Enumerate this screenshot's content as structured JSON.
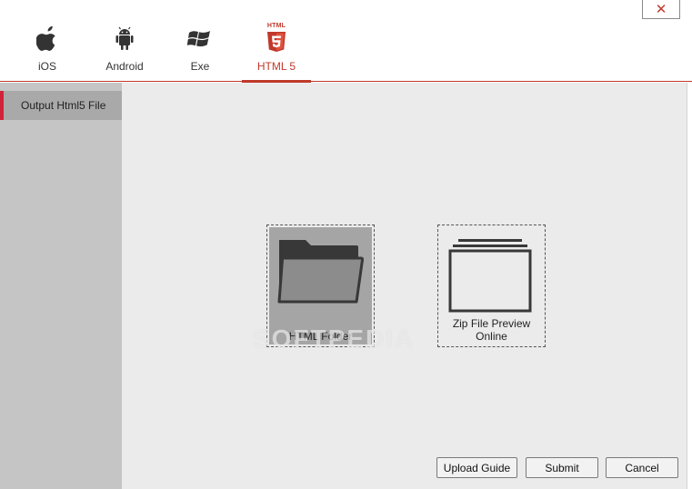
{
  "window": {
    "close_symbol": "✕"
  },
  "tabs": [
    {
      "label": "iOS",
      "icon": "apple-icon"
    },
    {
      "label": "Android",
      "icon": "android-icon"
    },
    {
      "label": "Exe",
      "icon": "windows-icon"
    },
    {
      "label": "HTML 5",
      "icon": "html5-icon",
      "badge": "HTML",
      "active": true
    }
  ],
  "sidebar": {
    "items": [
      {
        "label": "Output Html5 File",
        "active": true
      }
    ]
  },
  "options": [
    {
      "label": "HTML Folder",
      "icon": "folder-icon",
      "selected": true
    },
    {
      "label_line1": "Zip File Preview",
      "label_line2": "Online",
      "icon": "zip-pages-icon",
      "selected": false
    }
  ],
  "watermark": "SOFTPEDIA",
  "buttons": {
    "upload_guide": "Upload Guide",
    "submit": "Submit",
    "cancel": "Cancel"
  },
  "colors": {
    "accent": "#c0392b",
    "sidebar_bg": "#c5c5c5",
    "main_bg": "#ebebeb",
    "selected_bg": "#a5a5a5"
  }
}
